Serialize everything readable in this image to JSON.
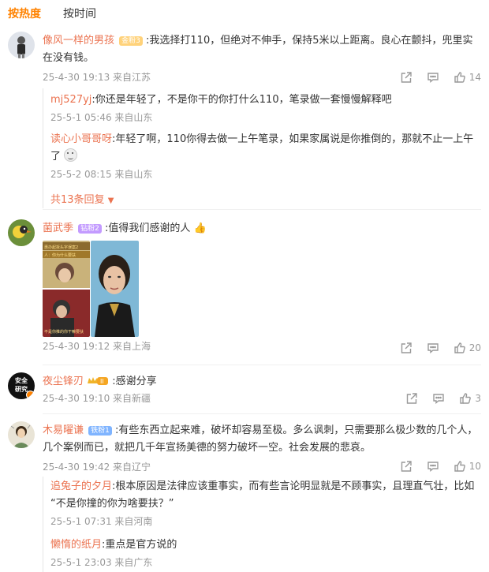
{
  "tabs": {
    "hot": "按热度",
    "time": "按时间"
  },
  "comments": [
    {
      "user": "像风一样的男孩",
      "badge": "金粉3",
      "text": ":我选择打110，但绝对不伸手，保持5米以上距离。良心在颤抖，兜里实在没有钱。",
      "line1": ":我选择打110，但绝对不伸手，保持5米以上距离。良心在颤抖，兜里实",
      "line2": "在没有钱。",
      "meta": "25-4-30 19:13 来自江苏",
      "likes": "14",
      "replies": [
        {
          "user": "mj527yj",
          "text": ":你还是年轻了，不是你干的你打什么110，笔录做一套慢慢解释吧",
          "meta": "25-5-1 05:46 来自山东"
        },
        {
          "user": "读心小哥哥呀",
          "line1": ":年轻了啊，110你得去做一上午笔录，如果家属说是你推倒的，那就不止一上午",
          "line2": "了",
          "meta": "25-5-2 08:15 来自山东"
        }
      ],
      "more": "共13条回复"
    },
    {
      "user": "菌武季",
      "badge": "钻粉2",
      "text": ":值得我们感谢的人",
      "meta": "25-4-30 19:12 来自上海",
      "likes": "20",
      "image_caption_1": "惠办起拆头字误案2",
      "image_caption_2": "人：你为什么要扶",
      "image_caption_3": "不是你推的你干嘛要扶"
    },
    {
      "user": "夜尘锋刃",
      "avatar_text": "安全研究",
      "text": ":感谢分享",
      "meta": "25-4-30 19:10 来自新疆",
      "likes": "3"
    },
    {
      "user": "木易曜谦",
      "badge": "铁粉1",
      "line1": ":有些东西立起来难，破坏却容易至极。多么讽刺，只需要那么极少数的几个人，",
      "line2": "几个案例而已，就把几千年宣扬美德的努力破坏一空。社会发展的悲哀。",
      "meta": "25-4-30 19:42 来自辽宁",
      "likes": "10",
      "replies": [
        {
          "user": "追兔子的夕月",
          "line1": ":根本原因是法律应该重事实，而有些言论明显就是不顾事实，且理直气壮，比如",
          "line2": "“不是你撞的你为啥要扶？”",
          "meta": "25-5-1 07:31 来自河南"
        },
        {
          "user": "懒惰的纸月",
          "text": ":重点是官方说的",
          "meta": "25-5-1 23:03 来自广东"
        }
      ]
    }
  ]
}
